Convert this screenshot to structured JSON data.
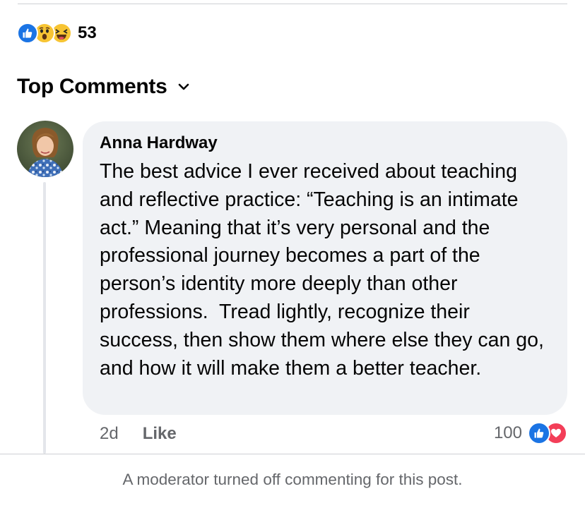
{
  "post": {
    "reaction_types": [
      "like-icon",
      "wow-icon",
      "haha-icon"
    ],
    "reaction_count": "53"
  },
  "comments_header": {
    "label": "Top Comments",
    "icon": "chevron-down-icon"
  },
  "comment": {
    "author": "Anna Hardway",
    "text": "The best advice I ever received about teaching and reflective practice: “Teaching is an intimate act.” Meaning that it’s very personal and the professional journey becomes a part of the person’s identity more deeply than other professions.  Tread lightly, recognize their success, then show them where else they can go, and how it will make them a better teacher.",
    "time": "2d",
    "like_label": "Like",
    "reaction_count": "100",
    "reaction_types": [
      "like-icon",
      "love-icon"
    ]
  },
  "footer": {
    "moderator_note": "A moderator turned off commenting for this post."
  },
  "colors": {
    "like_blue": "#1b74e4",
    "love_red": "#f33e58",
    "emoji_yellow": "#f7c433",
    "bubble_bg": "#f0f2f5",
    "secondary_text": "#65676b"
  }
}
